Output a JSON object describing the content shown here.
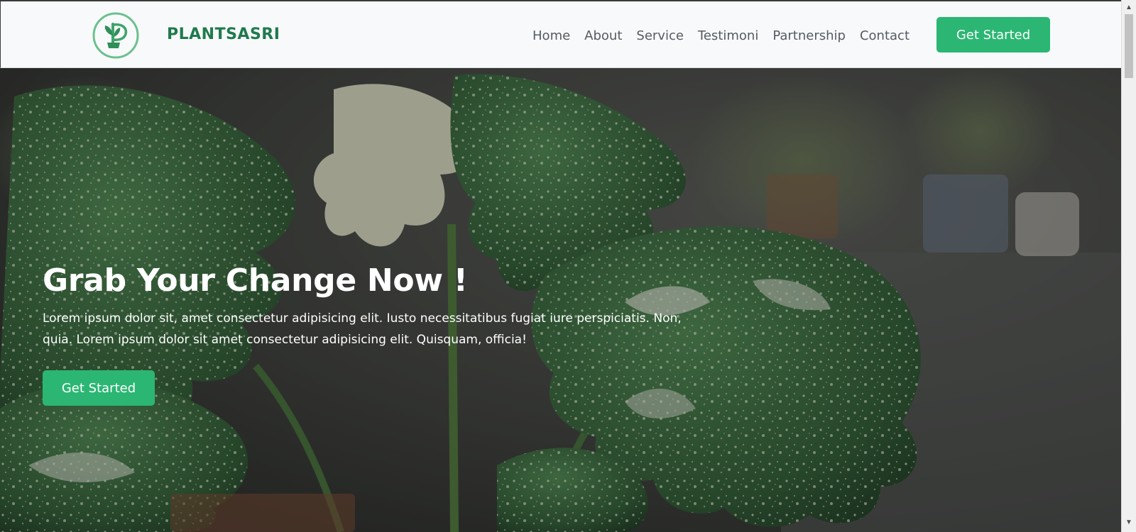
{
  "navbar": {
    "brand": "PLANTSASRI",
    "logo_icon": "plant-logo-icon",
    "links": [
      "Home",
      "About",
      "Service",
      "Testimoni",
      "Partnership",
      "Contact"
    ],
    "cta_label": "Get Started"
  },
  "hero": {
    "title": "Grab Your Change Now !",
    "text": "Lorem ipsum dolor sit, amet consectetur adipisicing elit. Iusto necessitatibus fugiat iure perspiciatis. Non, quia. Lorem ipsum dolor sit amet consectetur adipisicing elit. Quisquam, officia!",
    "cta_label": "Get Started",
    "background": "monstera-plant-photo"
  },
  "colors": {
    "accent": "#2bb673",
    "brand": "#1f7a4d",
    "nav_bg": "#f8f9fa",
    "nav_text": "#555b61"
  }
}
